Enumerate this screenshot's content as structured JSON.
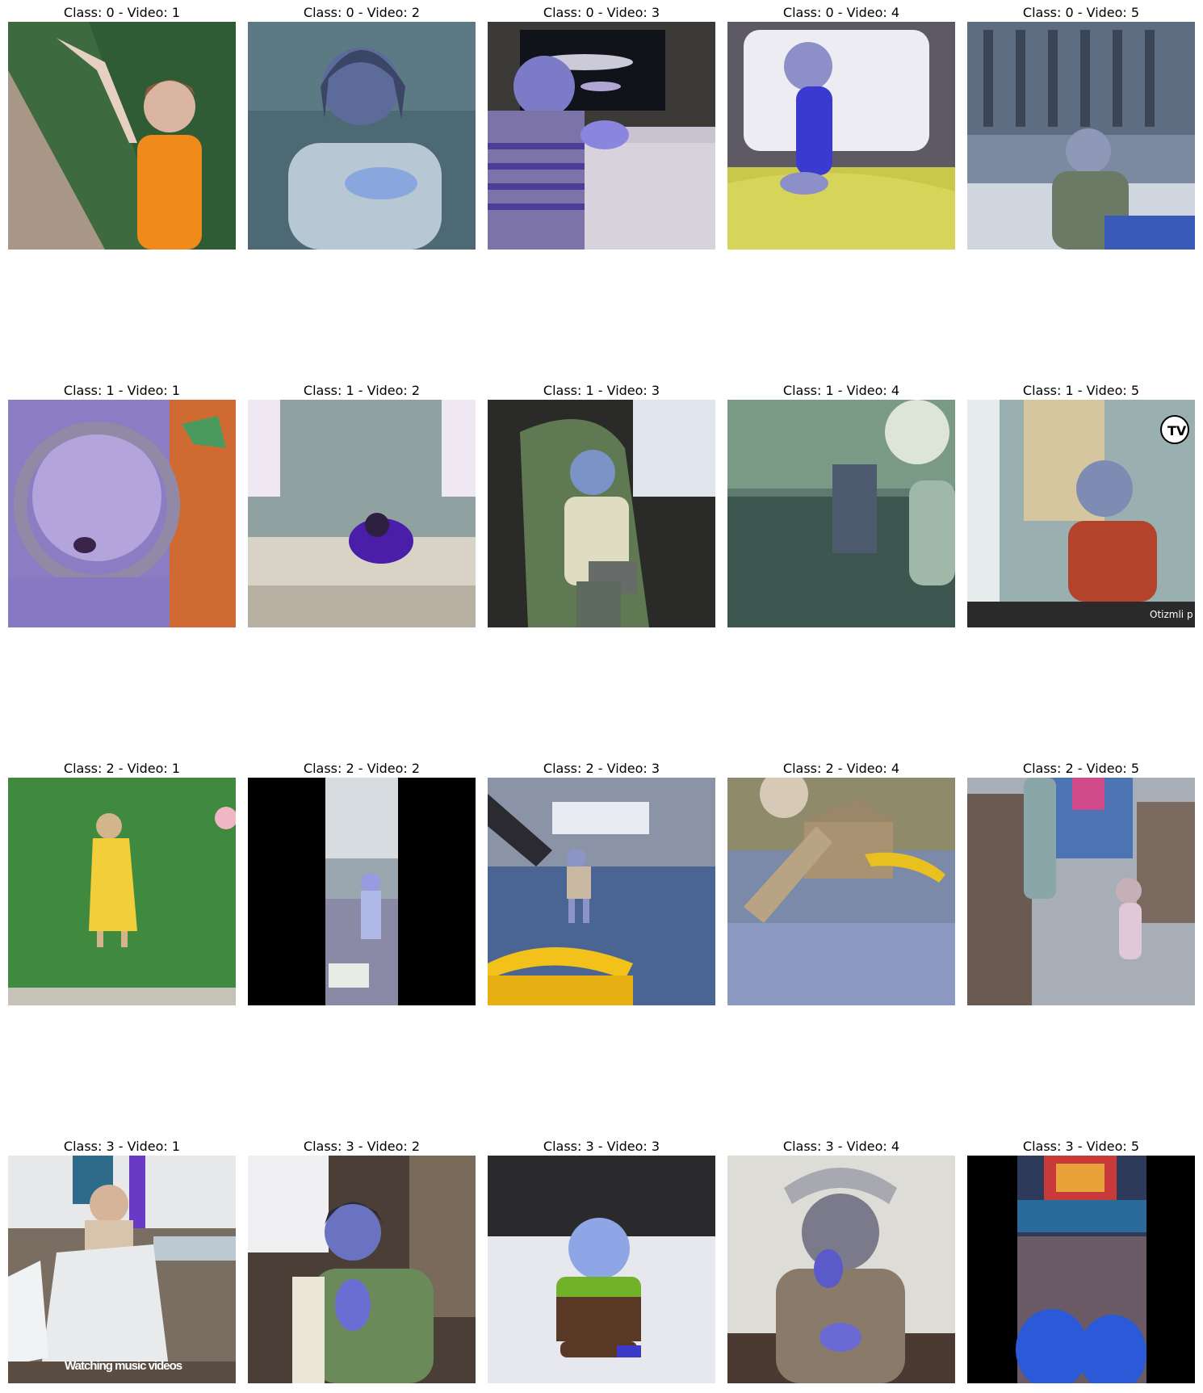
{
  "grid": {
    "rows": [
      {
        "class": 0,
        "cells": [
          {
            "title": "Class: 0 - Video: 1",
            "scene": "Child in orange shirt outdoors on grass"
          },
          {
            "title": "Class: 0 - Video: 2",
            "scene": "Toddler in light sweater indoors"
          },
          {
            "title": "Class: 0 - Video: 3",
            "scene": "Blurry child in striped shirt near picture frame"
          },
          {
            "title": "Class: 0 - Video: 4",
            "scene": "Baby sitting on bed with pillow"
          },
          {
            "title": "Class: 0 - Video: 5",
            "scene": "Smiling baby near crib"
          }
        ]
      },
      {
        "class": 1,
        "cells": [
          {
            "title": "Class: 1 - Video: 1",
            "scene": "Child wearing clear face shield"
          },
          {
            "title": "Class: 1 - Video: 2",
            "scene": "Child hunched on bed by windows"
          },
          {
            "title": "Class: 1 - Video: 3",
            "scene": "Child in green car seat"
          },
          {
            "title": "Class: 1 - Video: 4",
            "scene": "Dim scene with child on couch"
          },
          {
            "title": "Class: 1 - Video: 5",
            "scene": "Toddler at glass door",
            "logo": "TV",
            "caption": "Otizmli p"
          }
        ]
      },
      {
        "class": 2,
        "cells": [
          {
            "title": "Class: 2 - Video: 1",
            "scene": "Child in yellow dress on lawn"
          },
          {
            "title": "Class: 2 - Video: 2",
            "scene": "Vertical video of living room with black bars"
          },
          {
            "title": "Class: 2 - Video: 3",
            "scene": "Child on blue floor with yellow chair"
          },
          {
            "title": "Class: 2 - Video: 4",
            "scene": "Wooden playset with yellow slide"
          },
          {
            "title": "Class: 2 - Video: 5",
            "scene": "Toddler in room with couch and toys"
          }
        ]
      },
      {
        "class": 3,
        "cells": [
          {
            "title": "Class: 3 - Video: 1",
            "scene": "Woman on couch with blanket",
            "caption": "Watching music videos"
          },
          {
            "title": "Class: 3 - Video: 2",
            "scene": "Boy in car seat with clasped hands"
          },
          {
            "title": "Class: 3 - Video: 3",
            "scene": "Baby in overalls sitting on bed"
          },
          {
            "title": "Class: 3 - Video: 4",
            "scene": "Child wearing headband with hands to mouth"
          },
          {
            "title": "Class: 3 - Video: 5",
            "scene": "Vertical video of hands with TV in background"
          }
        ]
      }
    ]
  }
}
